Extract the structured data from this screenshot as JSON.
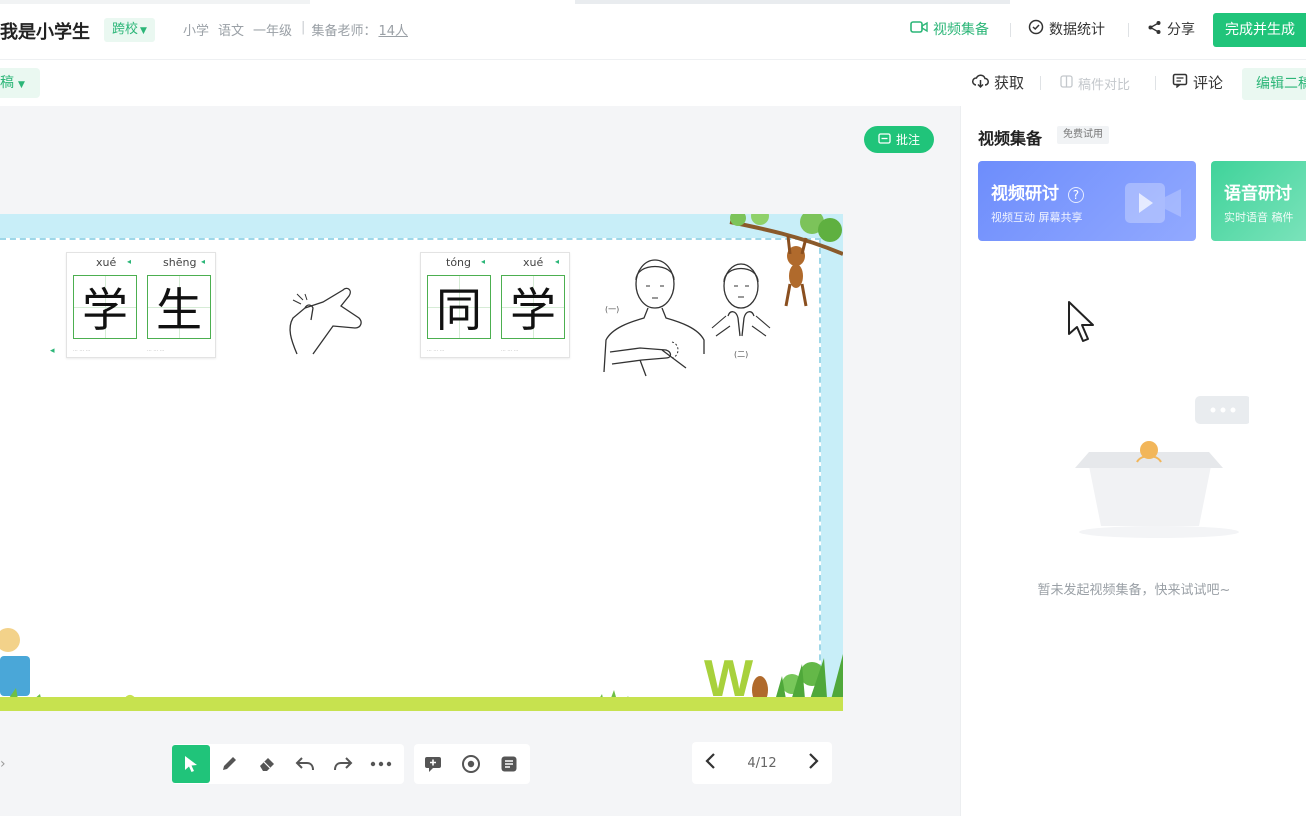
{
  "header": {
    "title": "我是小学生",
    "school_tag": "跨校",
    "meta": {
      "stage": "小学",
      "subject": "语文",
      "grade": "一年级",
      "teachers_label": "集备老师：",
      "teachers_count": "14人"
    },
    "video_prep": "视频集备",
    "statistics": "数据统计",
    "share": "分享",
    "finish": "完成并生成"
  },
  "subbar": {
    "left_tab": "稿",
    "fetch": "获取",
    "compare": "稿件对比",
    "comment": "评论",
    "edit": "编辑二稿"
  },
  "canvas": {
    "annotate": "批注",
    "cards": [
      {
        "pinyin": [
          "xué",
          "shēng"
        ],
        "chars": [
          "学",
          "生"
        ]
      },
      {
        "pinyin": [
          "tóng",
          "xué"
        ],
        "chars": [
          "同",
          "学"
        ]
      }
    ],
    "sign_labels": [
      "(一)",
      "(二)"
    ]
  },
  "toolbar": {
    "tools": [
      "select-icon",
      "pen-icon",
      "eraser-icon",
      "undo-icon",
      "redo-icon",
      "more-icon"
    ],
    "extra": [
      "comment-icon",
      "eye-icon",
      "note-icon"
    ]
  },
  "pager": {
    "current": "4/12"
  },
  "panel": {
    "title": "视频集备",
    "trial": "免费试用",
    "video_card": {
      "title": "视频研讨",
      "sub": "视频互动  屏幕共享"
    },
    "voice_card": {
      "title": "语音研讨",
      "sub": "实时语音  稿件"
    },
    "empty": "暂未发起视频集备，快来试试吧~"
  },
  "colors": {
    "accent": "#20c47a",
    "video_card": "#7b97fd",
    "voice_card": "#55dba8",
    "canvas_bg": "#f4f5f7"
  }
}
